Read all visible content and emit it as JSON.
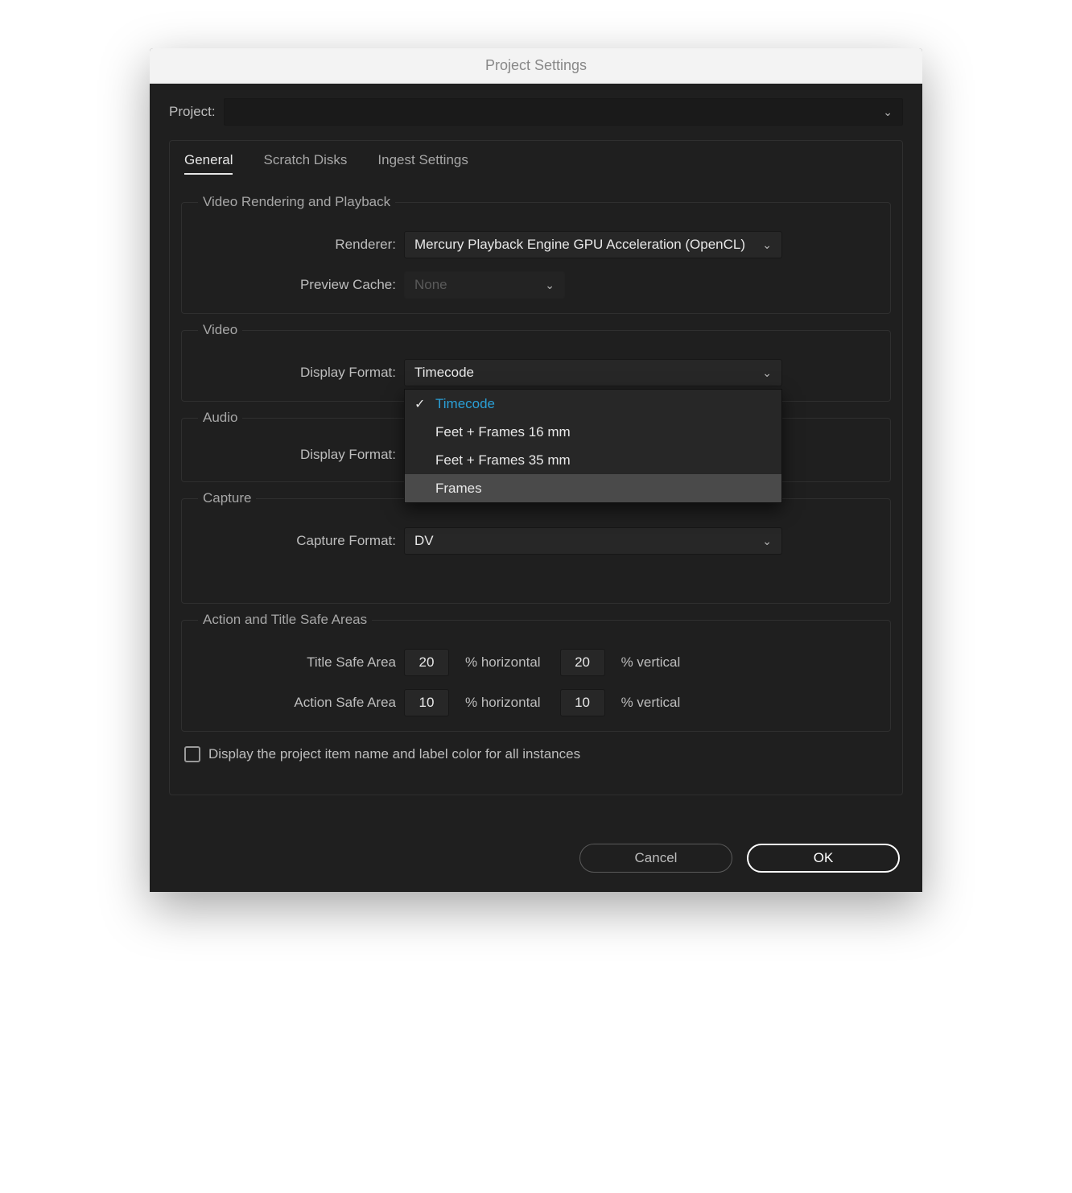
{
  "window": {
    "title": "Project Settings"
  },
  "project": {
    "label": "Project:",
    "value": ""
  },
  "tabs": [
    "General",
    "Scratch Disks",
    "Ingest Settings"
  ],
  "sections": {
    "video_render": {
      "legend": "Video Rendering and Playback",
      "renderer": {
        "label": "Renderer:",
        "value": "Mercury Playback Engine GPU Acceleration (OpenCL)"
      },
      "preview_cache": {
        "label": "Preview Cache:",
        "value": "None"
      }
    },
    "video": {
      "legend": "Video",
      "display_format": {
        "label": "Display Format:",
        "value": "Timecode",
        "options": [
          "Timecode",
          "Feet + Frames 16 mm",
          "Feet + Frames 35 mm",
          "Frames"
        ],
        "open": true,
        "selected_index": 0,
        "hover_index": 3
      }
    },
    "audio": {
      "legend": "Audio",
      "display_format": {
        "label": "Display Format:"
      }
    },
    "capture": {
      "legend": "Capture",
      "capture_format": {
        "label": "Capture Format:",
        "value": "DV"
      }
    },
    "safe_areas": {
      "legend": "Action and Title Safe Areas",
      "title_safe": {
        "label": "Title Safe Area",
        "h": "20",
        "v": "20"
      },
      "action_safe": {
        "label": "Action Safe Area",
        "h": "10",
        "v": "10"
      },
      "unit_h": "% horizontal",
      "unit_v": "% vertical"
    }
  },
  "checkbox": {
    "label": "Display the project item name and label color for all instances",
    "checked": false
  },
  "buttons": {
    "cancel": "Cancel",
    "ok": "OK"
  }
}
